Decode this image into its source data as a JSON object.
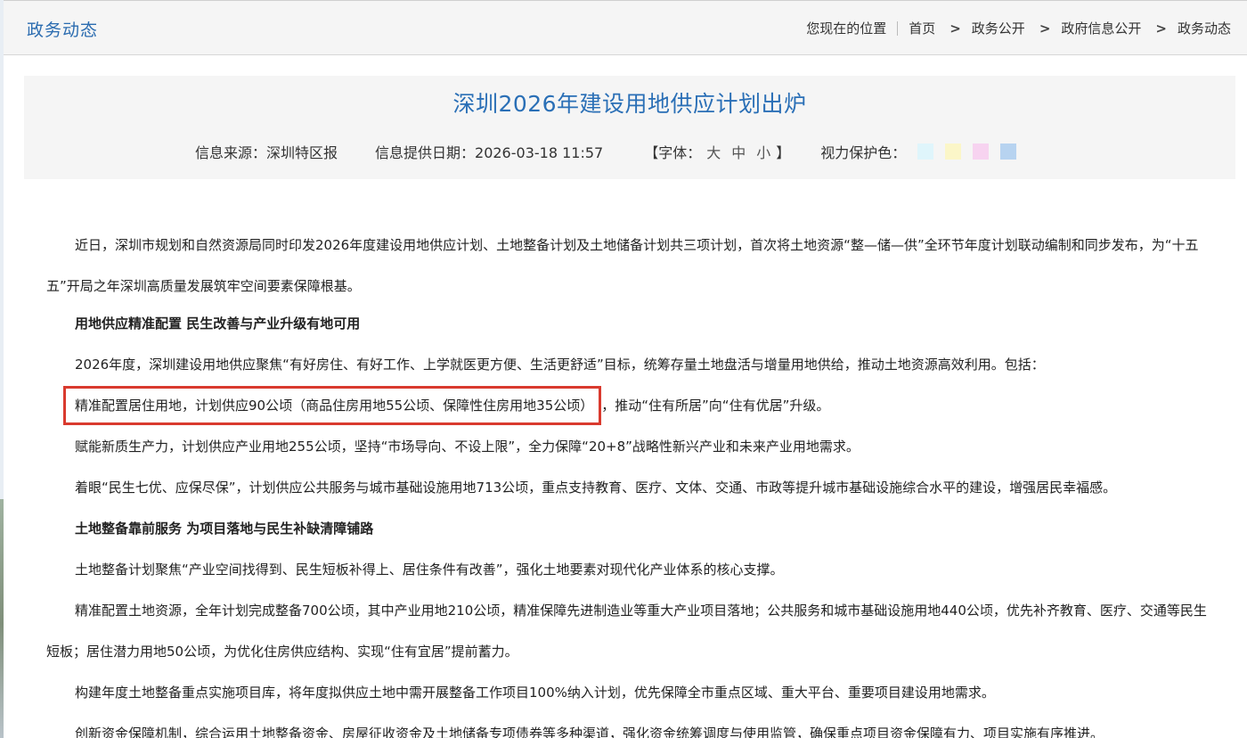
{
  "topbar": {
    "section_title": "政务动态",
    "location_label": "您现在的位置",
    "breadcrumb": [
      "首页",
      "政务公开",
      "政府信息公开",
      "政务动态"
    ],
    "separator": ">"
  },
  "article": {
    "title": "深圳2026年建设用地供应计划出炉",
    "source": "信息来源：深圳特区报",
    "date": "信息提供日期：2026-03-18 11:57",
    "font_label": "【字体：",
    "font_sizes": [
      "大",
      "中",
      "小"
    ],
    "font_close": "】",
    "eye_care_label": "视力保护色：",
    "eye_care_colors": [
      "#dff5fb",
      "#fbf6c8",
      "#f7d3f0",
      "#b7d3f0"
    ]
  },
  "body": {
    "p1": "近日，深圳市规划和自然资源局同时印发2026年度建设用地供应计划、土地整备计划及土地储备计划共三项计划，首次将土地资源“整—储—供”全环节年度计划联动编制和同步发布，为“十五五”开局之年深圳高质量发展筑牢空间要素保障根基。",
    "h1": "用地供应精准配置 民生改善与产业升级有地可用",
    "p2": "2026年度，深圳建设用地供应聚焦“有好房住、有好工作、上学就医更方便、生活更舒适”目标，统筹存量土地盘活与增量用地供给，推动土地资源高效利用。包括：",
    "p3_highlight": "精准配置居住用地，计划供应90公顷（商品住房用地55公顷、保障性住房用地35公顷）",
    "p3_rest": "，推动“住有所居”向“住有优居”升级。",
    "p4": "赋能新质生产力，计划供应产业用地255公顷，坚持“市场导向、不设上限”，全力保障“20+8”战略性新兴产业和未来产业用地需求。",
    "p5": "着眼“民生七优、应保尽保”，计划供应公共服务与城市基础设施用地713公顷，重点支持教育、医疗、文体、交通、市政等提升城市基础设施综合水平的建设，增强居民幸福感。",
    "h2": "土地整备靠前服务 为项目落地与民生补缺清障铺路",
    "p6": "土地整备计划聚焦“产业空间找得到、民生短板补得上、居住条件有改善”，强化土地要素对现代化产业体系的核心支撑。",
    "p7": "精准配置土地资源，全年计划完成整备700公顷，其中产业用地210公顷，精准保障先进制造业等重大产业项目落地；公共服务和城市基础设施用地440公顷，优先补齐教育、医疗、交通等民生短板；居住潜力用地50公顷，为优化住房供应结构、实现“住有宜居”提前蓄力。",
    "p8": "构建年度土地整备重点实施项目库，将年度拟供应土地中需开展整备工作项目100%纳入计划，优先保障全市重点区域、重大平台、重要项目建设用地需求。",
    "p9": "创新资金保障机制，综合运用土地整备资金、房屋征收资金及土地储备专项债券等多种渠道，强化资金统筹调度与使用监管，确保重点项目资金保障有力、项目实施有序推进。"
  },
  "colors": {
    "accent_blue": "#2a6fb6",
    "highlight_border": "#d93a2e"
  }
}
